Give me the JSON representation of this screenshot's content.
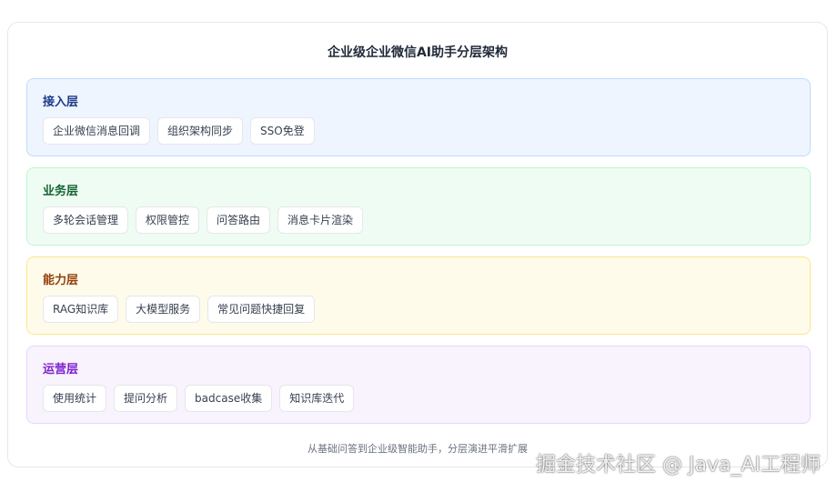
{
  "title": "企业级企业微信AI助手分层架构",
  "layers": [
    {
      "label": "接入层",
      "label_color": "#1e3a8a",
      "bg": "#eef5ff",
      "border": "#bfdbfe",
      "items": [
        "企业微信消息回调",
        "组织架构同步",
        "SSO免登"
      ]
    },
    {
      "label": "业务层",
      "label_color": "#166534",
      "bg": "#effcf3",
      "border": "#bbf7d0",
      "items": [
        "多轮会话管理",
        "权限管控",
        "问答路由",
        "消息卡片渲染"
      ]
    },
    {
      "label": "能力层",
      "label_color": "#92400e",
      "bg": "#fffbea",
      "border": "#fde68a",
      "items": [
        "RAG知识库",
        "大模型服务",
        "常见问题快捷回复"
      ]
    },
    {
      "label": "运营层",
      "label_color": "#7e22ce",
      "bg": "#f8f3fd",
      "border": "#e9d5ff",
      "items": [
        "使用统计",
        "提问分析",
        "badcase收集",
        "知识库迭代"
      ]
    }
  ],
  "caption": "从基础问答到企业级智能助手，分层演进平滑扩展",
  "watermark": "掘金技术社区 @ Java_AI工程师"
}
